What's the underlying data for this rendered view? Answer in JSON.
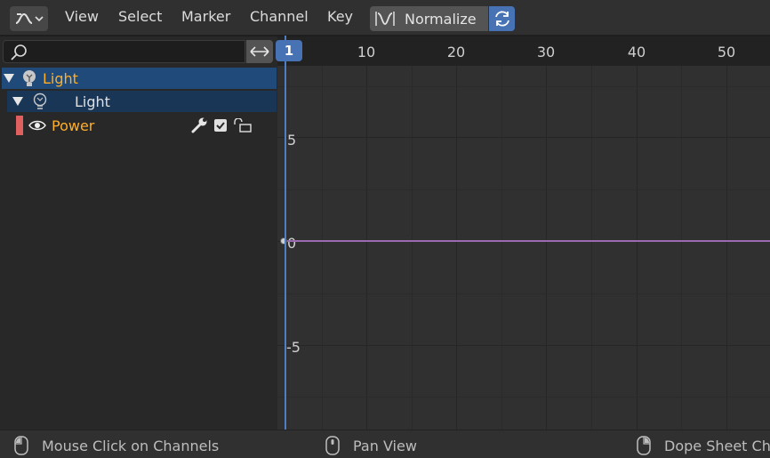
{
  "header": {
    "editor_type_icon": "graph-editor-icon",
    "menus": [
      "View",
      "Select",
      "Marker",
      "Channel",
      "Key"
    ],
    "normalize_label": "Normalize",
    "colors": {
      "accent": "#4772b3"
    }
  },
  "channels": {
    "search": {
      "value": "",
      "placeholder": ""
    },
    "object_label": "Light",
    "data_label": "Light",
    "fcurve_label": "Power",
    "fcurve_color": "#e06060",
    "selected_label_color": "#ffaf29"
  },
  "timeline": {
    "current_frame": "1",
    "frame_labels": [
      "10",
      "20",
      "30",
      "40",
      "50"
    ]
  },
  "graph": {
    "y_labels": [
      "5",
      "0",
      "-5"
    ],
    "curve_color": "#9a6bb0"
  },
  "statusbar": {
    "items": [
      "Mouse Click on Channels",
      "Pan View",
      "Dope Sheet Ch"
    ]
  }
}
